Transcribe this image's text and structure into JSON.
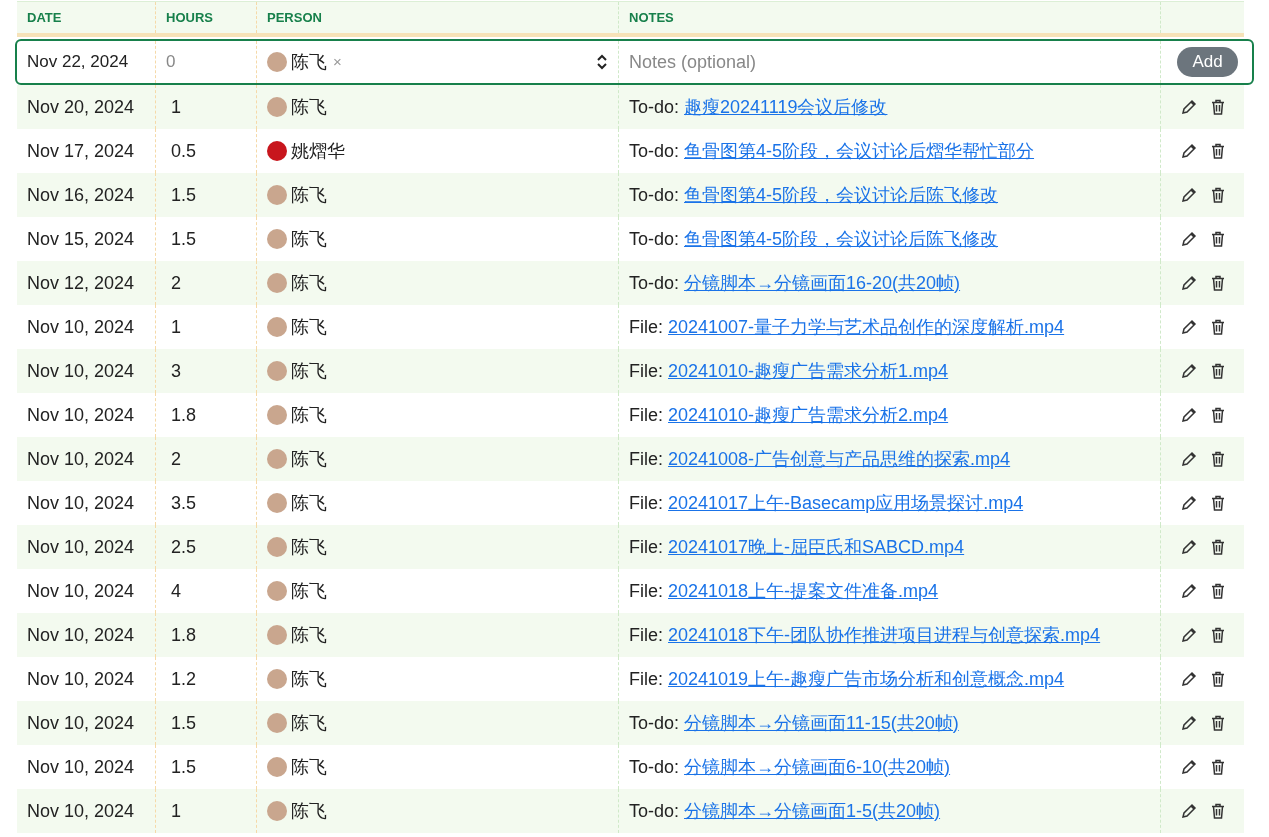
{
  "columns": [
    "DATE",
    "HOURS",
    "PERSON",
    "NOTES"
  ],
  "new_entry": {
    "date": "Nov 22, 2024",
    "hours": "0",
    "person": {
      "name": "陈飞",
      "color": "#c9a68e"
    },
    "remove": "×",
    "notes_placeholder": "Notes (optional)",
    "add_button": "Add"
  },
  "rows": [
    {
      "date": "Nov 20, 2024",
      "hours": "1",
      "person": "陈飞",
      "color": "#c9a68e",
      "prefix": "To-do:",
      "link": "趣瘦20241119会议后修改"
    },
    {
      "date": "Nov 17, 2024",
      "hours": "0.5",
      "person": "姚熠华",
      "color": "#c8161d",
      "prefix": "To-do:",
      "link": "鱼骨图第4-5阶段，会议讨论后熠华帮忙部分"
    },
    {
      "date": "Nov 16, 2024",
      "hours": "1.5",
      "person": "陈飞",
      "color": "#c9a68e",
      "prefix": "To-do:",
      "link": "鱼骨图第4-5阶段，会议讨论后陈飞修改"
    },
    {
      "date": "Nov 15, 2024",
      "hours": "1.5",
      "person": "陈飞",
      "color": "#c9a68e",
      "prefix": "To-do:",
      "link": "鱼骨图第4-5阶段，会议讨论后陈飞修改"
    },
    {
      "date": "Nov 12, 2024",
      "hours": "2",
      "person": "陈飞",
      "color": "#c9a68e",
      "prefix": "To-do:",
      "link": "分镜脚本→分镜画面16-20(共20帧)"
    },
    {
      "date": "Nov 10, 2024",
      "hours": "1",
      "person": "陈飞",
      "color": "#c9a68e",
      "prefix": "File:",
      "link": "20241007-量子力学与艺术品创作的深度解析.mp4"
    },
    {
      "date": "Nov 10, 2024",
      "hours": "3",
      "person": "陈飞",
      "color": "#c9a68e",
      "prefix": "File:",
      "link": "20241010-趣瘦广告需求分析1.mp4"
    },
    {
      "date": "Nov 10, 2024",
      "hours": "1.8",
      "person": "陈飞",
      "color": "#c9a68e",
      "prefix": "File:",
      "link": "20241010-趣瘦广告需求分析2.mp4"
    },
    {
      "date": "Nov 10, 2024",
      "hours": "2",
      "person": "陈飞",
      "color": "#c9a68e",
      "prefix": "File:",
      "link": "20241008-广告创意与产品思维的探索.mp4"
    },
    {
      "date": "Nov 10, 2024",
      "hours": "3.5",
      "person": "陈飞",
      "color": "#c9a68e",
      "prefix": "File:",
      "link": "20241017上午-Basecamp应用场景探讨.mp4"
    },
    {
      "date": "Nov 10, 2024",
      "hours": "2.5",
      "person": "陈飞",
      "color": "#c9a68e",
      "prefix": "File:",
      "link": "20241017晚上-屈臣氏和SABCD.mp4"
    },
    {
      "date": "Nov 10, 2024",
      "hours": "4",
      "person": "陈飞",
      "color": "#c9a68e",
      "prefix": "File:",
      "link": "20241018上午-提案文件准备.mp4"
    },
    {
      "date": "Nov 10, 2024",
      "hours": "1.8",
      "person": "陈飞",
      "color": "#c9a68e",
      "prefix": "File:",
      "link": "20241018下午-团队协作推进项目进程与创意探索.mp4"
    },
    {
      "date": "Nov 10, 2024",
      "hours": "1.2",
      "person": "陈飞",
      "color": "#c9a68e",
      "prefix": "File:",
      "link": "20241019上午-趣瘦广告市场分析和创意概念.mp4"
    },
    {
      "date": "Nov 10, 2024",
      "hours": "1.5",
      "person": "陈飞",
      "color": "#c9a68e",
      "prefix": "To-do:",
      "link": "分镜脚本→分镜画面11-15(共20帧)"
    },
    {
      "date": "Nov 10, 2024",
      "hours": "1.5",
      "person": "陈飞",
      "color": "#c9a68e",
      "prefix": "To-do:",
      "link": "分镜脚本→分镜画面6-10(共20帧)"
    },
    {
      "date": "Nov 10, 2024",
      "hours": "1",
      "person": "陈飞",
      "color": "#c9a68e",
      "prefix": "To-do:",
      "link": "分镜脚本→分镜画面1-5(共20帧)"
    }
  ]
}
